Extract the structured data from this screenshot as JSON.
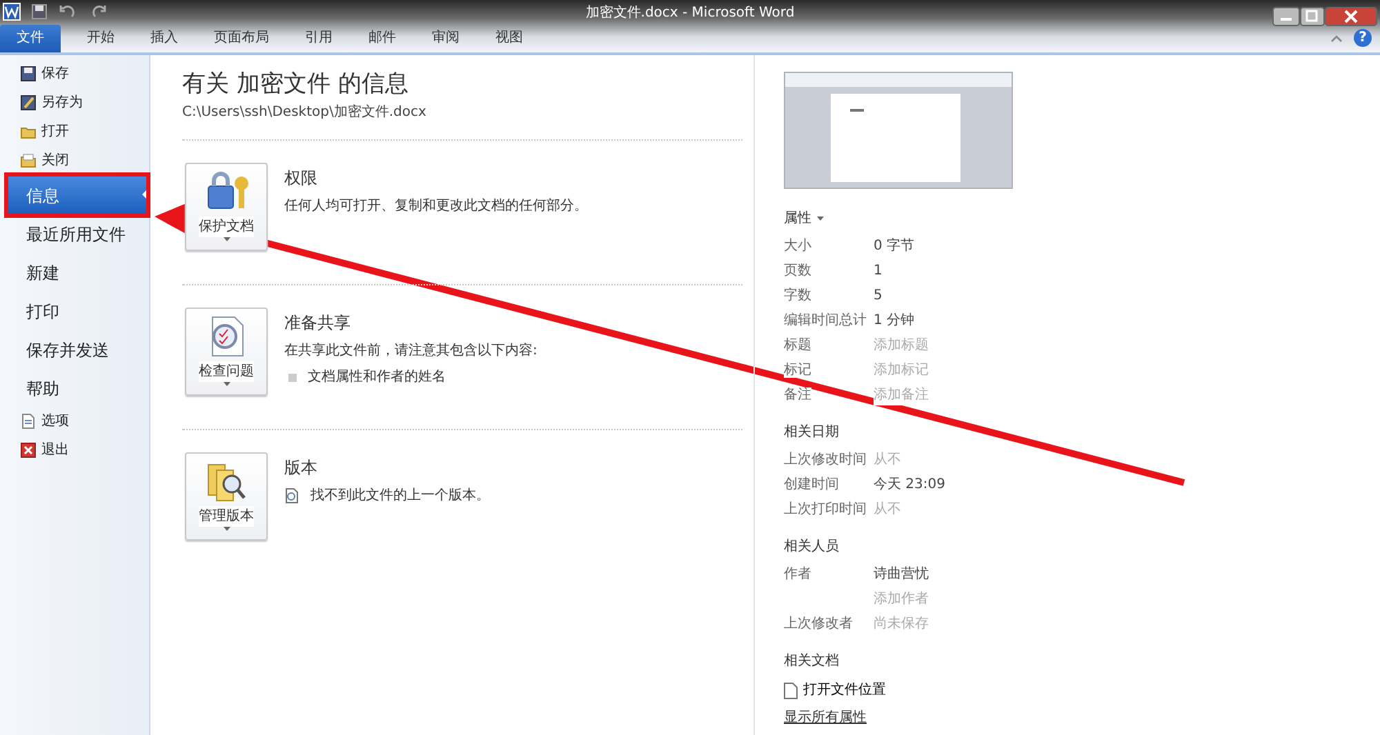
{
  "window": {
    "title": "加密文件.docx - Microsoft Word",
    "help_glyph": "?"
  },
  "ribbon_tabs": [
    {
      "label": "文件",
      "selected": true
    },
    {
      "label": "开始",
      "selected": false
    },
    {
      "label": "插入",
      "selected": false
    },
    {
      "label": "页面布局",
      "selected": false
    },
    {
      "label": "引用",
      "selected": false
    },
    {
      "label": "邮件",
      "selected": false
    },
    {
      "label": "审阅",
      "selected": false
    },
    {
      "label": "视图",
      "selected": false
    }
  ],
  "backstage_menu": [
    {
      "kind": "command",
      "label": "保存"
    },
    {
      "kind": "command",
      "label": "另存为"
    },
    {
      "kind": "command",
      "label": "打开"
    },
    {
      "kind": "command",
      "label": "关闭"
    },
    {
      "kind": "page",
      "label": "信息",
      "selected": true
    },
    {
      "kind": "page",
      "label": "最近所用文件",
      "selected": false
    },
    {
      "kind": "page",
      "label": "新建",
      "selected": false
    },
    {
      "kind": "page",
      "label": "打印",
      "selected": false
    },
    {
      "kind": "page",
      "label": "保存并发送",
      "selected": false
    },
    {
      "kind": "page",
      "label": "帮助",
      "selected": false
    },
    {
      "kind": "command",
      "label": "选项"
    },
    {
      "kind": "command",
      "label": "退出"
    }
  ],
  "info": {
    "title": "有关 加密文件 的信息",
    "path": "C:\\Users\\ssh\\Desktop\\加密文件.docx",
    "sections": [
      {
        "button": "保护文档",
        "heading": "权限",
        "description": "任何人均可打开、复制和更改此文档的任何部分。"
      },
      {
        "button": "检查问题",
        "heading": "准备共享",
        "description": "在共享此文件前，请注意其包含以下内容:",
        "items": [
          {
            "kind": "bullet",
            "text": "文档属性和作者的姓名"
          }
        ]
      },
      {
        "button": "管理版本",
        "heading": "版本",
        "items": [
          {
            "kind": "note",
            "text": "找不到此文件的上一个版本。"
          }
        ]
      }
    ]
  },
  "properties": {
    "heading": "属性",
    "rows": [
      {
        "label": "大小",
        "value": "0 字节",
        "dimmed": false
      },
      {
        "label": "页数",
        "value": "1",
        "dimmed": false
      },
      {
        "label": "字数",
        "value": "5",
        "dimmed": false
      },
      {
        "label": "编辑时间总计",
        "value": "1 分钟",
        "dimmed": false
      },
      {
        "label": "标题",
        "value": "添加标题",
        "dimmed": true
      },
      {
        "label": "标记",
        "value": "添加标记",
        "dimmed": true
      },
      {
        "label": "备注",
        "value": "添加备注",
        "dimmed": true
      }
    ]
  },
  "related_dates": {
    "heading": "相关日期",
    "rows": [
      {
        "label": "上次修改时间",
        "value": "从不",
        "dimmed": true
      },
      {
        "label": "创建时间",
        "value": "今天 23:09",
        "dimmed": false
      },
      {
        "label": "上次打印时间",
        "value": "从不",
        "dimmed": true
      }
    ]
  },
  "related_people": {
    "heading": "相关人员",
    "rows": [
      {
        "label": "作者",
        "value": "诗曲营忧",
        "dimmed": false
      },
      {
        "value": "添加作者",
        "dimmed": true
      },
      {
        "label": "上次修改者",
        "value": "尚未保存",
        "dimmed": true
      }
    ]
  },
  "related_documents": {
    "heading": "相关文档",
    "links": [
      {
        "text": "打开文件位置"
      }
    ],
    "show_all": "显示所有属性"
  }
}
